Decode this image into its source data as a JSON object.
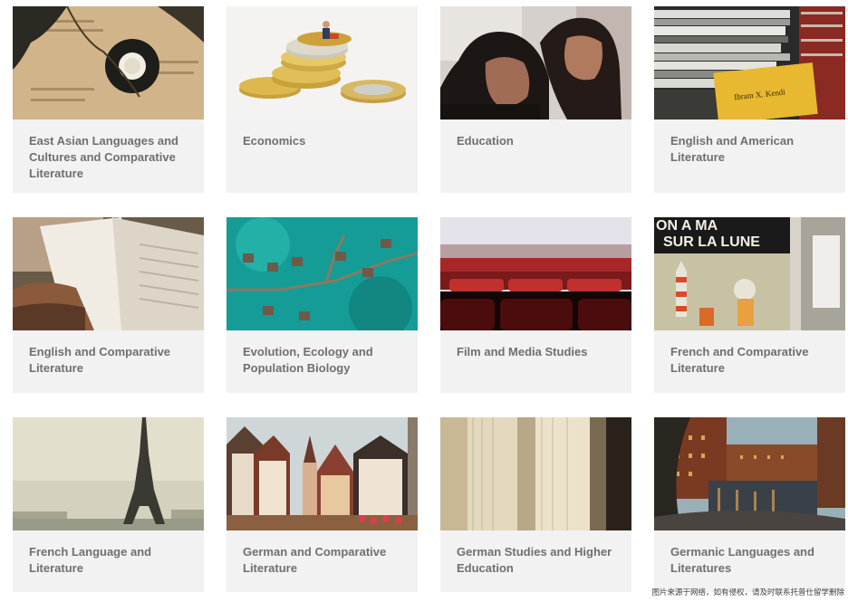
{
  "cards": [
    {
      "title": "East Asian Languages and Cultures and Comparative Literature",
      "image": "tea-cup-on-book"
    },
    {
      "title": "Economics",
      "image": "coins-with-figure"
    },
    {
      "title": "Education",
      "image": "teacher-and-student"
    },
    {
      "title": "English and American Literature",
      "image": "stack-of-books"
    },
    {
      "title": "English and Comparative Literature",
      "image": "open-book"
    },
    {
      "title": "Evolution, Ecology and Population Biology",
      "image": "overwater-bungalows"
    },
    {
      "title": "Film and Media Studies",
      "image": "cinema-seats"
    },
    {
      "title": "French and Comparative Literature",
      "image": "comic-poster"
    },
    {
      "title": "French Language and Literature",
      "image": "eiffel-tower"
    },
    {
      "title": "German and Comparative Literature",
      "image": "german-old-town"
    },
    {
      "title": "German Studies and Higher Education",
      "image": "book-pages"
    },
    {
      "title": "Germanic Languages and Literatures",
      "image": "canal-warehouses"
    }
  ],
  "watermark": "图片来源于网络，如有侵权，请及时联系托普仕留学删除"
}
